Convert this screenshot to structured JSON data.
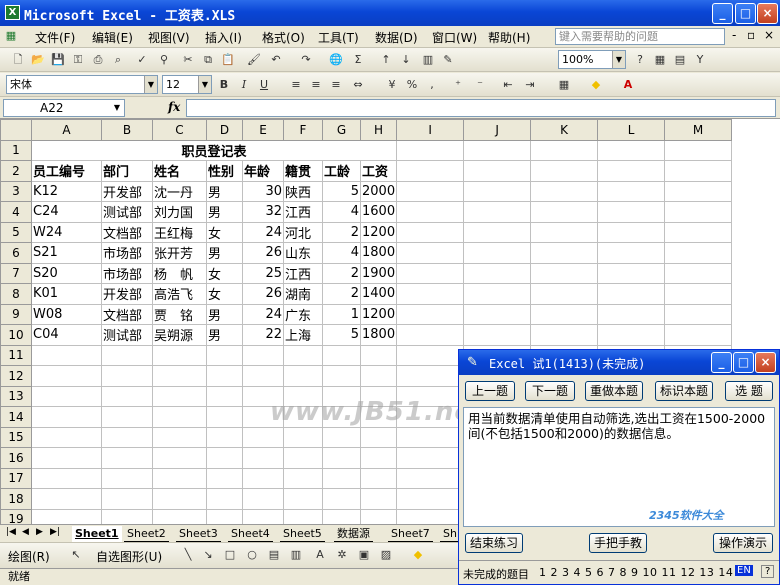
{
  "window": {
    "title": "Microsoft Excel - 工资表.XLS",
    "btn_min": "_",
    "btn_max": "□",
    "btn_close": "×"
  },
  "menu": [
    "文件(F)",
    "编辑(E)",
    "视图(V)",
    "插入(I)",
    "格式(O)",
    "工具(T)",
    "数据(D)",
    "窗口(W)",
    "帮助(H)"
  ],
  "help_placeholder": "键入需要帮助的问题",
  "toolbar": {
    "zoom": "100%",
    "font": "宋体",
    "size": "12",
    "bold": "B",
    "italic": "I",
    "underline": "U",
    "percent": "%"
  },
  "formula": {
    "namebox": "A22",
    "fx": "fx",
    "value": ""
  },
  "columns": [
    "A",
    "B",
    "C",
    "D",
    "E",
    "F",
    "G",
    "H",
    "I",
    "J",
    "K",
    "L",
    "M"
  ],
  "rows": [
    "1",
    "2",
    "3",
    "4",
    "5",
    "6",
    "7",
    "8",
    "9",
    "10",
    "11",
    "12",
    "13",
    "14",
    "15",
    "16",
    "17",
    "18",
    "19"
  ],
  "sheet": {
    "title": "职员登记表",
    "headers": [
      "员工编号",
      "部门",
      "姓名",
      "性别",
      "年龄",
      "籍贯",
      "工龄",
      "工资"
    ],
    "data": [
      [
        "K12",
        "开发部",
        "沈一丹",
        "男",
        "30",
        "陕西",
        "5",
        "2000"
      ],
      [
        "C24",
        "测试部",
        "刘力国",
        "男",
        "32",
        "江西",
        "4",
        "1600"
      ],
      [
        "W24",
        "文档部",
        "王红梅",
        "女",
        "24",
        "河北",
        "2",
        "1200"
      ],
      [
        "S21",
        "市场部",
        "张开芳",
        "男",
        "26",
        "山东",
        "4",
        "1800"
      ],
      [
        "S20",
        "市场部",
        "杨　帆",
        "女",
        "25",
        "江西",
        "2",
        "1900"
      ],
      [
        "K01",
        "开发部",
        "高浩飞",
        "女",
        "26",
        "湖南",
        "2",
        "1400"
      ],
      [
        "W08",
        "文档部",
        "贾　铭",
        "男",
        "24",
        "广东",
        "1",
        "1200"
      ],
      [
        "C04",
        "测试部",
        "吴朔源",
        "男",
        "22",
        "上海",
        "5",
        "1800"
      ]
    ]
  },
  "tabs": [
    "Sheet1",
    "Sheet2",
    "Sheet3",
    "Sheet4",
    "Sheet5",
    "数据源",
    "Sheet7",
    "Sh"
  ],
  "drawbar": {
    "draw": "绘图(R)",
    "autoshape": "自选图形(U)"
  },
  "status": "就绪",
  "watermark": "www.JB51.net / AngTe.com",
  "task_window": {
    "title": "Excel 试1(1413)(未完成)",
    "buttons": [
      "上一题",
      "下一题",
      "重做本题",
      "标识本题",
      "选 题"
    ],
    "question": "用当前数据清单使用自动筛选,选出工资在1500-2000间(不包括1500和2000)的数据信息。",
    "bottom_buttons": [
      "结束练习",
      "手把手教",
      "操作演示"
    ],
    "status_label": "未完成的题目",
    "question_numbers": "1 2 3 4 5 6 7 8 9 10 11 12 13 14",
    "lang": "EN",
    "help": "?",
    "logo": "2345软件大全"
  }
}
